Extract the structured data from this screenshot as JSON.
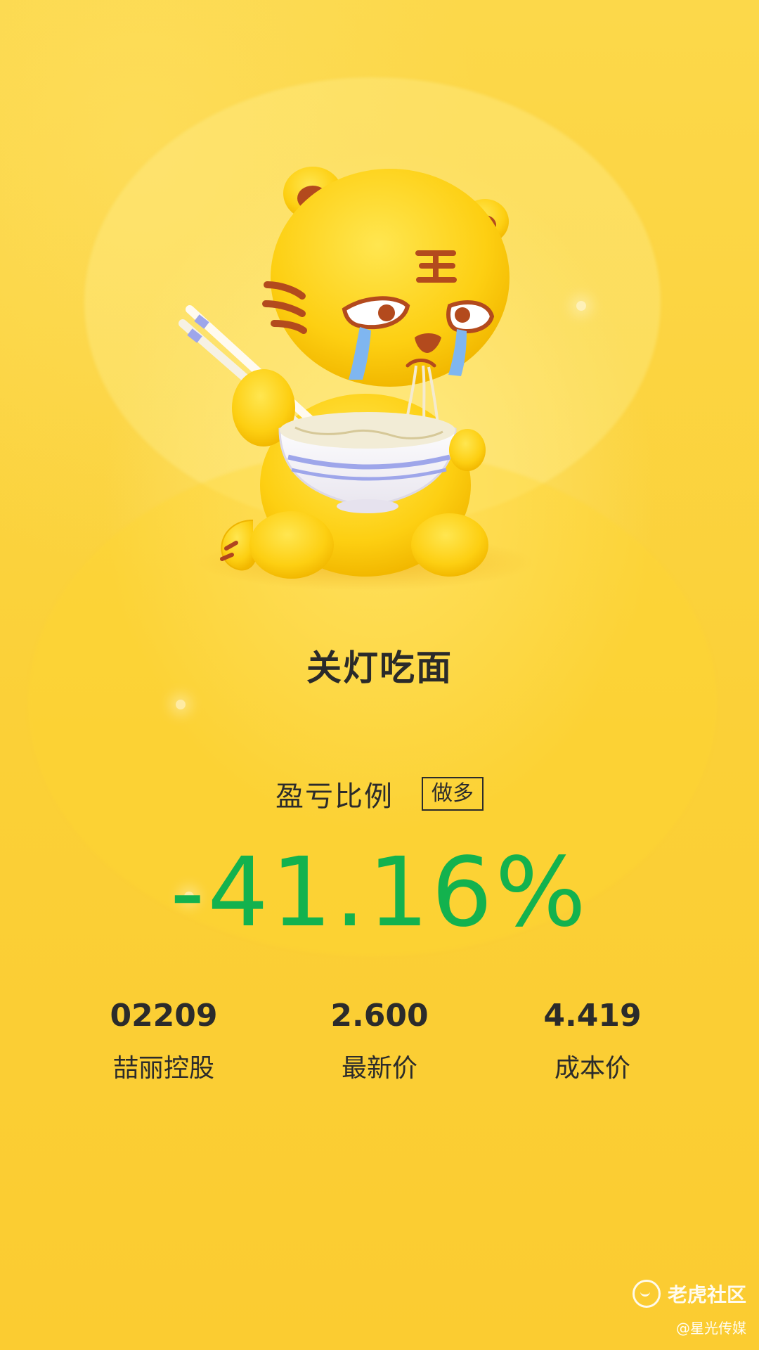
{
  "title": "关灯吃面",
  "ratio": {
    "label": "盈亏比例",
    "badge": "做多",
    "value": "-41.16%",
    "color": "#13b24e"
  },
  "stats": [
    {
      "value": "02209",
      "label": "喆丽控股"
    },
    {
      "value": "2.600",
      "label": "最新价"
    },
    {
      "value": "4.419",
      "label": "成本价"
    }
  ],
  "watermark": {
    "brand": "老虎社区",
    "credit": "@星光传媒"
  },
  "mascot": {
    "icon": "crying-tiger-eating-noodles-illustration"
  },
  "colors": {
    "background": "#fbd13a",
    "text": "#2b2b2b",
    "loss": "#13b24e"
  }
}
